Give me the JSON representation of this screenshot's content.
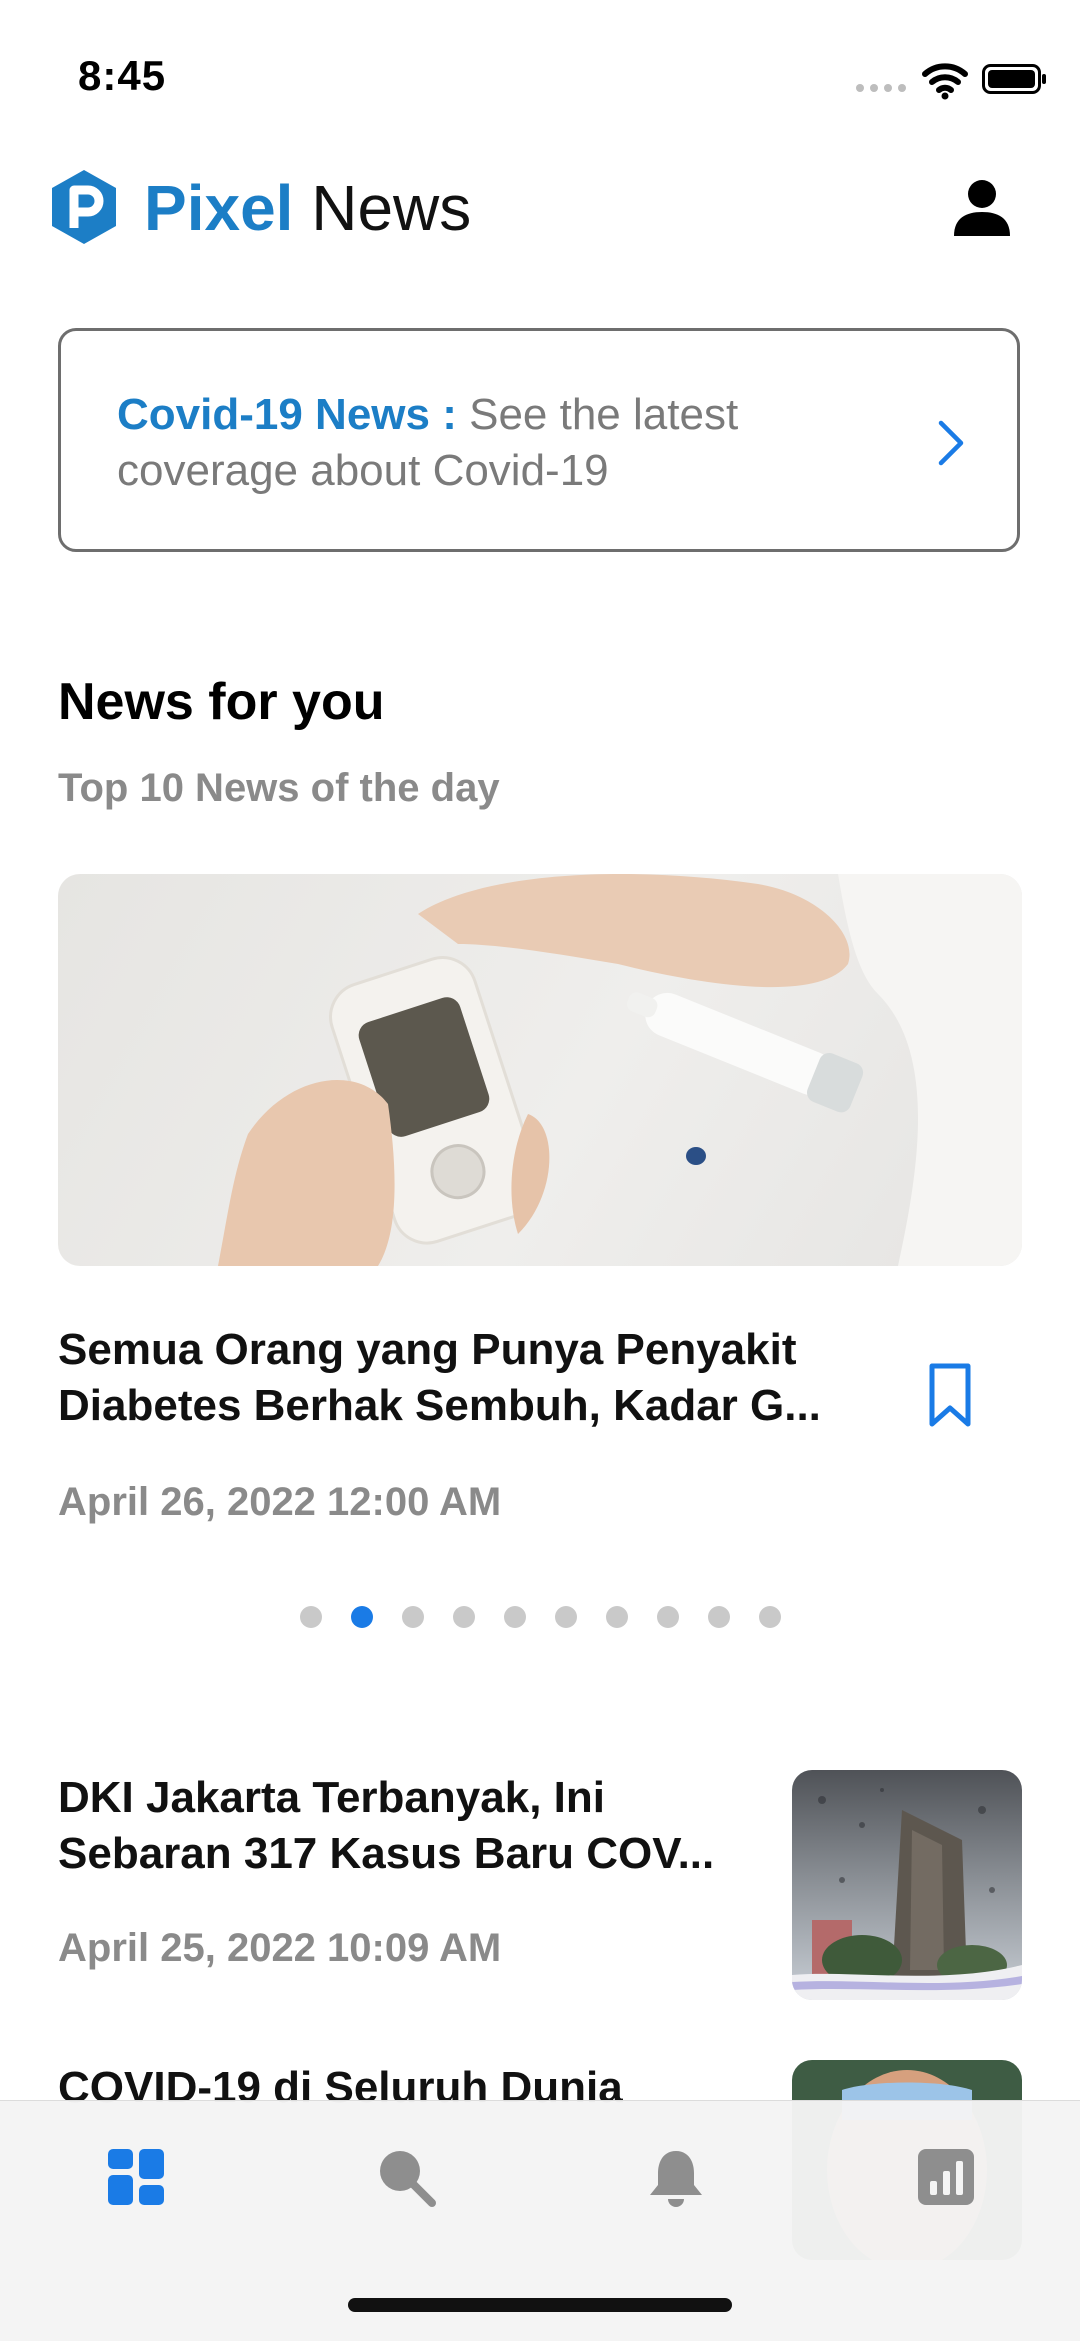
{
  "status_bar": {
    "time": "8:45"
  },
  "header": {
    "brand_primary": "Pixel",
    "brand_secondary": "News"
  },
  "covid_card": {
    "title": "Covid-19 News :",
    "text": " See the latest coverage about Covid-19"
  },
  "section": {
    "title": "News for you",
    "subtitle": "Top 10 News of the day"
  },
  "featured": {
    "title": "Semua Orang yang Punya Penyakit Diabetes Berhak Sembuh, Kadar G...",
    "date": "April 26, 2022 12:00 AM"
  },
  "pagination": {
    "total": 10,
    "active_index": 1
  },
  "news_list": [
    {
      "title": "DKI Jakarta Terbanyak, Ini Sebaran 317 Kasus Baru COV...",
      "date": "April 25, 2022 10:09 AM"
    },
    {
      "title": "COVID-19 di Seluruh Dunia"
    }
  ],
  "tabbar": {
    "items": [
      "dashboard-icon",
      "search-icon",
      "bell-icon",
      "chart-icon"
    ],
    "active": 0
  },
  "colors": {
    "brand": "#1c7ec6",
    "accent": "#1a7be6",
    "muted": "#8a8a8a",
    "inactive_tab": "#8e8e8e"
  }
}
